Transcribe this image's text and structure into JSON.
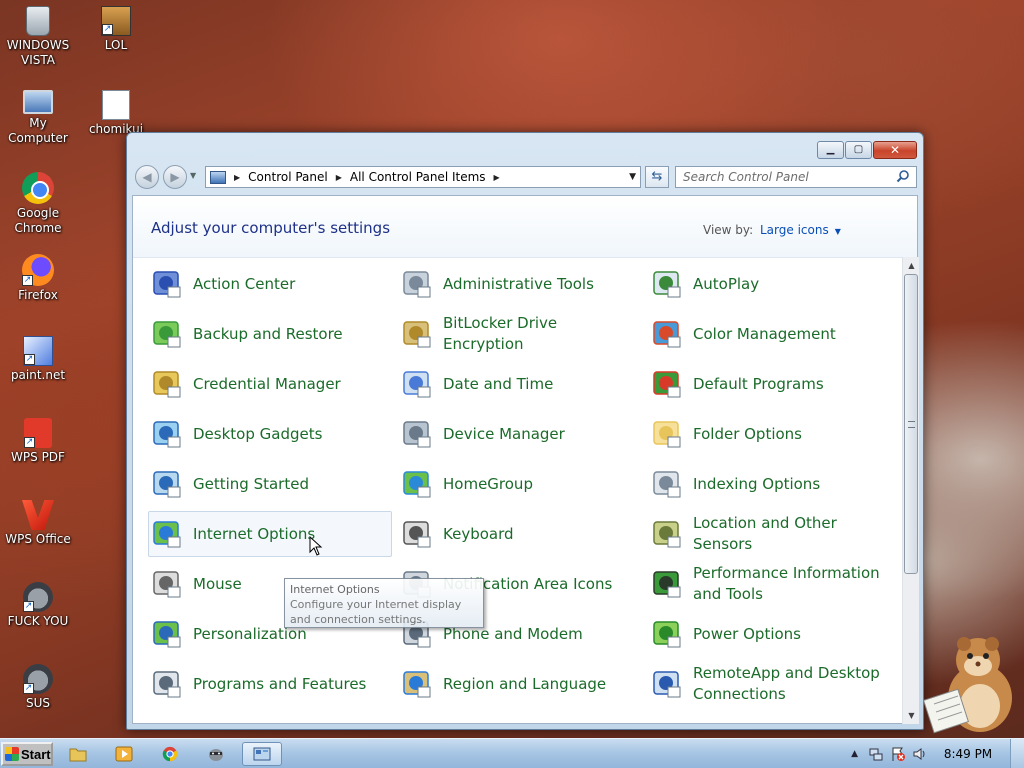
{
  "desktop": {
    "icons": [
      {
        "label": "WINDOWS VISTA",
        "icon": "recycle-bin-icon"
      },
      {
        "label": "LOL",
        "icon": "lol-shortcut-icon"
      },
      {
        "label": "My Computer",
        "icon": "computer-icon"
      },
      {
        "label": "chomikuj",
        "icon": "document-icon"
      },
      {
        "label": "Google Chrome",
        "icon": "chrome-icon"
      },
      {
        "label": "Firefox",
        "icon": "firefox-icon"
      },
      {
        "label": "paint.net",
        "icon": "paint-net-icon"
      },
      {
        "label": "WPS PDF",
        "icon": "wps-pdf-icon"
      },
      {
        "label": "WPS Office",
        "icon": "wps-office-icon"
      },
      {
        "label": "FUCK YOU",
        "icon": "raccoon-shortcut-icon"
      },
      {
        "label": "SUS",
        "icon": "raccoon-shortcut-icon"
      }
    ]
  },
  "window": {
    "breadcrumb": [
      "Control Panel",
      "All Control Panel Items"
    ],
    "search_placeholder": "Search Control Panel",
    "page_title": "Adjust your computer's settings",
    "view_by_label": "View by:",
    "view_by_value": "Large icons",
    "items": [
      {
        "label": "Action Center",
        "icon": "action-center-flag-icon"
      },
      {
        "label": "Administrative Tools",
        "icon": "administrative-tools-icon"
      },
      {
        "label": "AutoPlay",
        "icon": "autoplay-icon"
      },
      {
        "label": "Backup and Restore",
        "icon": "backup-restore-icon"
      },
      {
        "label": "BitLocker Drive Encryption",
        "icon": "bitlocker-key-icon"
      },
      {
        "label": "Color Management",
        "icon": "color-management-icon"
      },
      {
        "label": "Credential Manager",
        "icon": "credential-vault-icon"
      },
      {
        "label": "Date and Time",
        "icon": "calendar-clock-icon"
      },
      {
        "label": "Default Programs",
        "icon": "default-programs-icon"
      },
      {
        "label": "Desktop Gadgets",
        "icon": "desktop-gadgets-icon"
      },
      {
        "label": "Device Manager",
        "icon": "device-manager-icon"
      },
      {
        "label": "Folder Options",
        "icon": "folder-options-icon"
      },
      {
        "label": "Getting Started",
        "icon": "getting-started-icon"
      },
      {
        "label": "HomeGroup",
        "icon": "homegroup-icon"
      },
      {
        "label": "Indexing Options",
        "icon": "indexing-magnifier-icon"
      },
      {
        "label": "Internet Options",
        "icon": "internet-globe-icon"
      },
      {
        "label": "Keyboard",
        "icon": "keyboard-icon"
      },
      {
        "label": "Location and Other Sensors",
        "icon": "location-sensors-icon"
      },
      {
        "label": "Mouse",
        "icon": "mouse-icon"
      },
      {
        "label": "Notification Area Icons",
        "icon": "notification-area-icon"
      },
      {
        "label": "Performance Information and Tools",
        "icon": "performance-meter-icon"
      },
      {
        "label": "Personalization",
        "icon": "personalization-monitor-icon"
      },
      {
        "label": "Phone and Modem",
        "icon": "phone-modem-icon"
      },
      {
        "label": "Power Options",
        "icon": "power-battery-icon"
      },
      {
        "label": "Programs and Features",
        "icon": "programs-features-icon"
      },
      {
        "label": "Region and Language",
        "icon": "region-globe-clock-icon"
      },
      {
        "label": "RemoteApp and Desktop Connections",
        "icon": "remoteapp-icon"
      }
    ],
    "tooltip": {
      "title": "Internet Options",
      "text": "Configure your Internet display and connection settings."
    }
  },
  "taskbar": {
    "start_label": "Start",
    "clock": "8:49 PM"
  }
}
